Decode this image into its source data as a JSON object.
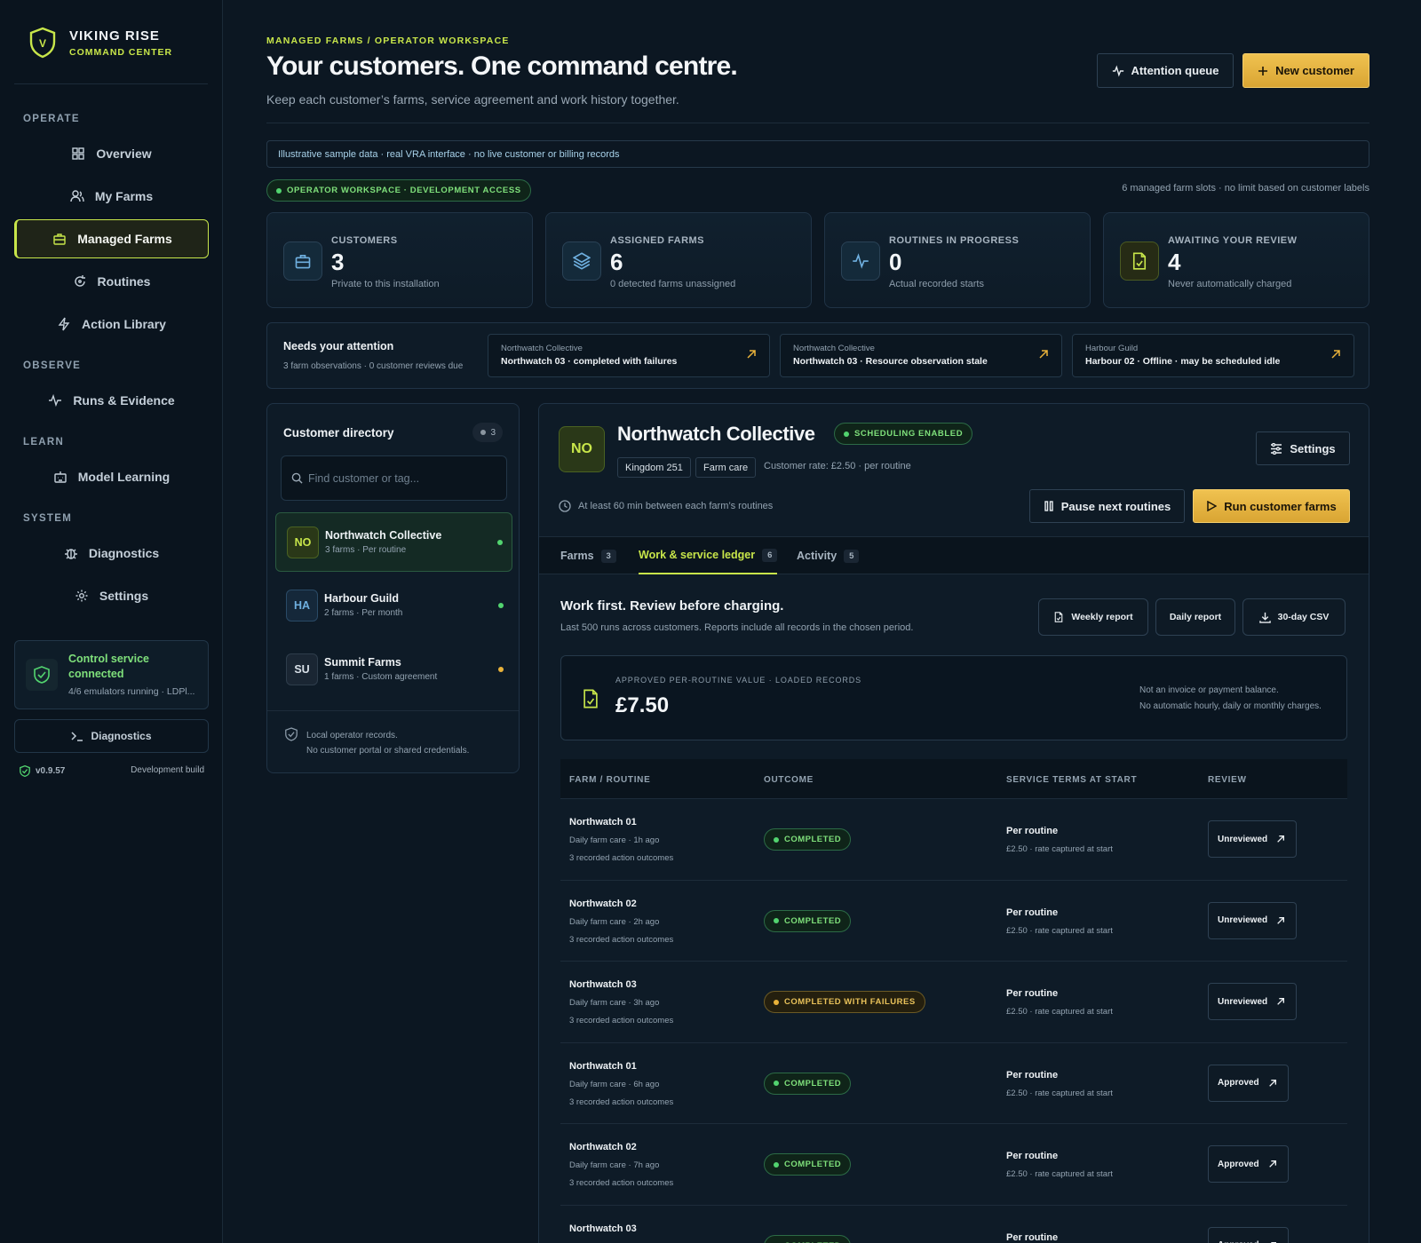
{
  "brand": {
    "title": "VIKING RISE",
    "subtitle": "COMMAND CENTER"
  },
  "nav": {
    "sections": [
      "OPERATE",
      "OBSERVE",
      "LEARN",
      "SYSTEM"
    ],
    "items": [
      {
        "label": "Overview",
        "icon": "grid-icon"
      },
      {
        "label": "My Farms",
        "icon": "users-icon"
      },
      {
        "label": "Managed Farms",
        "icon": "briefcase-icon",
        "active": true
      },
      {
        "label": "Routines",
        "icon": "refresh-icon"
      },
      {
        "label": "Action Library",
        "icon": "bolt-icon"
      },
      {
        "label": "Runs & Evidence",
        "icon": "pulse-icon"
      },
      {
        "label": "Model Learning",
        "icon": "robot-icon"
      },
      {
        "label": "Diagnostics",
        "icon": "bug-icon"
      },
      {
        "label": "Settings",
        "icon": "gear-icon"
      }
    ]
  },
  "service": {
    "title": "Control service connected",
    "subtitle": "4/6 emulators running · LDPl..."
  },
  "diagnostics_button": "Diagnostics",
  "version": "v0.9.57",
  "build": "Development build",
  "header": {
    "breadcrumb": "MANAGED FARMS / OPERATOR WORKSPACE",
    "title": "Your customers. One command centre.",
    "subtitle": "Keep each customer’s farms, service agreement and work history together.",
    "attention_button": "Attention queue",
    "new_customer_button": "New customer"
  },
  "notice": "Illustrative sample data · real VRA interface · no live customer or billing records",
  "workspace_pill": "OPERATOR WORKSPACE · DEVELOPMENT ACCESS",
  "slots_note": "6 managed farm slots · no limit based on customer labels",
  "stats": [
    {
      "label": "CUSTOMERS",
      "value": "3",
      "note": "Private to this installation",
      "icon": "briefcase-icon"
    },
    {
      "label": "ASSIGNED FARMS",
      "value": "6",
      "note": "0 detected farms unassigned",
      "icon": "layers-icon"
    },
    {
      "label": "ROUTINES IN PROGRESS",
      "value": "0",
      "note": "Actual recorded starts",
      "icon": "pulse-icon"
    },
    {
      "label": "AWAITING YOUR REVIEW",
      "value": "4",
      "note": "Never automatically charged",
      "icon": "file-check-icon"
    }
  ],
  "attention": {
    "title": "Needs your attention",
    "subtitle": "3 farm observations · 0 customer reviews due",
    "cards": [
      {
        "customer": "Northwatch Collective",
        "issue": "Northwatch 03 · completed with failures"
      },
      {
        "customer": "Northwatch Collective",
        "issue": "Northwatch 03 · Resource observation stale"
      },
      {
        "customer": "Harbour Guild",
        "issue": "Harbour 02 · Offline · may be scheduled idle"
      }
    ]
  },
  "directory": {
    "title": "Customer directory",
    "count": "3",
    "search_placeholder": "Find customer or tag...",
    "customers": [
      {
        "initials": "NO",
        "name": "Northwatch Collective",
        "meta": "3 farms · Per routine",
        "status_color": "#52d46f"
      },
      {
        "initials": "HA",
        "name": "Harbour Guild",
        "meta": "2 farms · Per month",
        "status_color": "#52d46f"
      },
      {
        "initials": "SU",
        "name": "Summit Farms",
        "meta": "1 farms · Custom agreement",
        "status_color": "#e9b23a"
      }
    ],
    "footer_line1": "Local operator records.",
    "footer_line2": "No customer portal or shared credentials."
  },
  "detail": {
    "initials": "NO",
    "name": "Northwatch Collective",
    "status": "SCHEDULING ENABLED",
    "tags": [
      "Kingdom 251",
      "Farm care"
    ],
    "rate": "Customer rate: £2.50 · per routine",
    "settings_button": "Settings",
    "gap_note": "At least 60 min between each farm’s routines",
    "pause_button": "Pause next routines",
    "run_button": "Run customer farms",
    "tabs": [
      {
        "label": "Farms",
        "count": "3"
      },
      {
        "label": "Work & service ledger",
        "count": "6",
        "active": true
      },
      {
        "label": "Activity",
        "count": "5"
      }
    ],
    "ledger_title": "Work first. Review before charging.",
    "ledger_subtitle": "Last 500 runs across customers. Reports include all records in the chosen period.",
    "report_buttons": [
      "Weekly report",
      "Daily report",
      "30-day CSV"
    ],
    "value_label": "APPROVED PER-ROUTINE VALUE · LOADED RECORDS",
    "value_amount": "£7.50",
    "value_note1": "Not an invoice or payment balance.",
    "value_note2": "No automatic hourly, daily or monthly charges.",
    "columns": [
      "FARM / ROUTINE",
      "OUTCOME",
      "SERVICE TERMS AT START",
      "REVIEW"
    ],
    "rows": [
      {
        "farm": "Northwatch 01",
        "routine": "Daily farm care · 1h ago",
        "outcomes": "3 recorded action outcomes",
        "status": "COMPLETED",
        "kind": "ok",
        "term": "Per routine",
        "term_note": "£2.50 · rate captured at start",
        "review": "Unreviewed"
      },
      {
        "farm": "Northwatch 02",
        "routine": "Daily farm care · 2h ago",
        "outcomes": "3 recorded action outcomes",
        "status": "COMPLETED",
        "kind": "ok",
        "term": "Per routine",
        "term_note": "£2.50 · rate captured at start",
        "review": "Unreviewed"
      },
      {
        "farm": "Northwatch 03",
        "routine": "Daily farm care · 3h ago",
        "outcomes": "3 recorded action outcomes",
        "status": "COMPLETED WITH FAILURES",
        "kind": "warn",
        "term": "Per routine",
        "term_note": "£2.50 · rate captured at start",
        "review": "Unreviewed"
      },
      {
        "farm": "Northwatch 01",
        "routine": "Daily farm care · 6h ago",
        "outcomes": "3 recorded action outcomes",
        "status": "COMPLETED",
        "kind": "ok",
        "term": "Per routine",
        "term_note": "£2.50 · rate captured at start",
        "review": "Approved"
      },
      {
        "farm": "Northwatch 02",
        "routine": "Daily farm care · 7h ago",
        "outcomes": "3 recorded action outcomes",
        "status": "COMPLETED",
        "kind": "ok",
        "term": "Per routine",
        "term_note": "£2.50 · rate captured at start",
        "review": "Approved"
      },
      {
        "farm": "Northwatch 03",
        "routine": "",
        "outcomes": "",
        "status": "COMPLETED",
        "kind": "ok",
        "term": "Per routine",
        "term_note": "",
        "review": "Approved"
      }
    ]
  },
  "colors": {
    "accent": "#c8e64a",
    "gold": "#e2b03d",
    "success": "#52d46f",
    "warning": "#e9b23a",
    "background": "#0c1722"
  }
}
